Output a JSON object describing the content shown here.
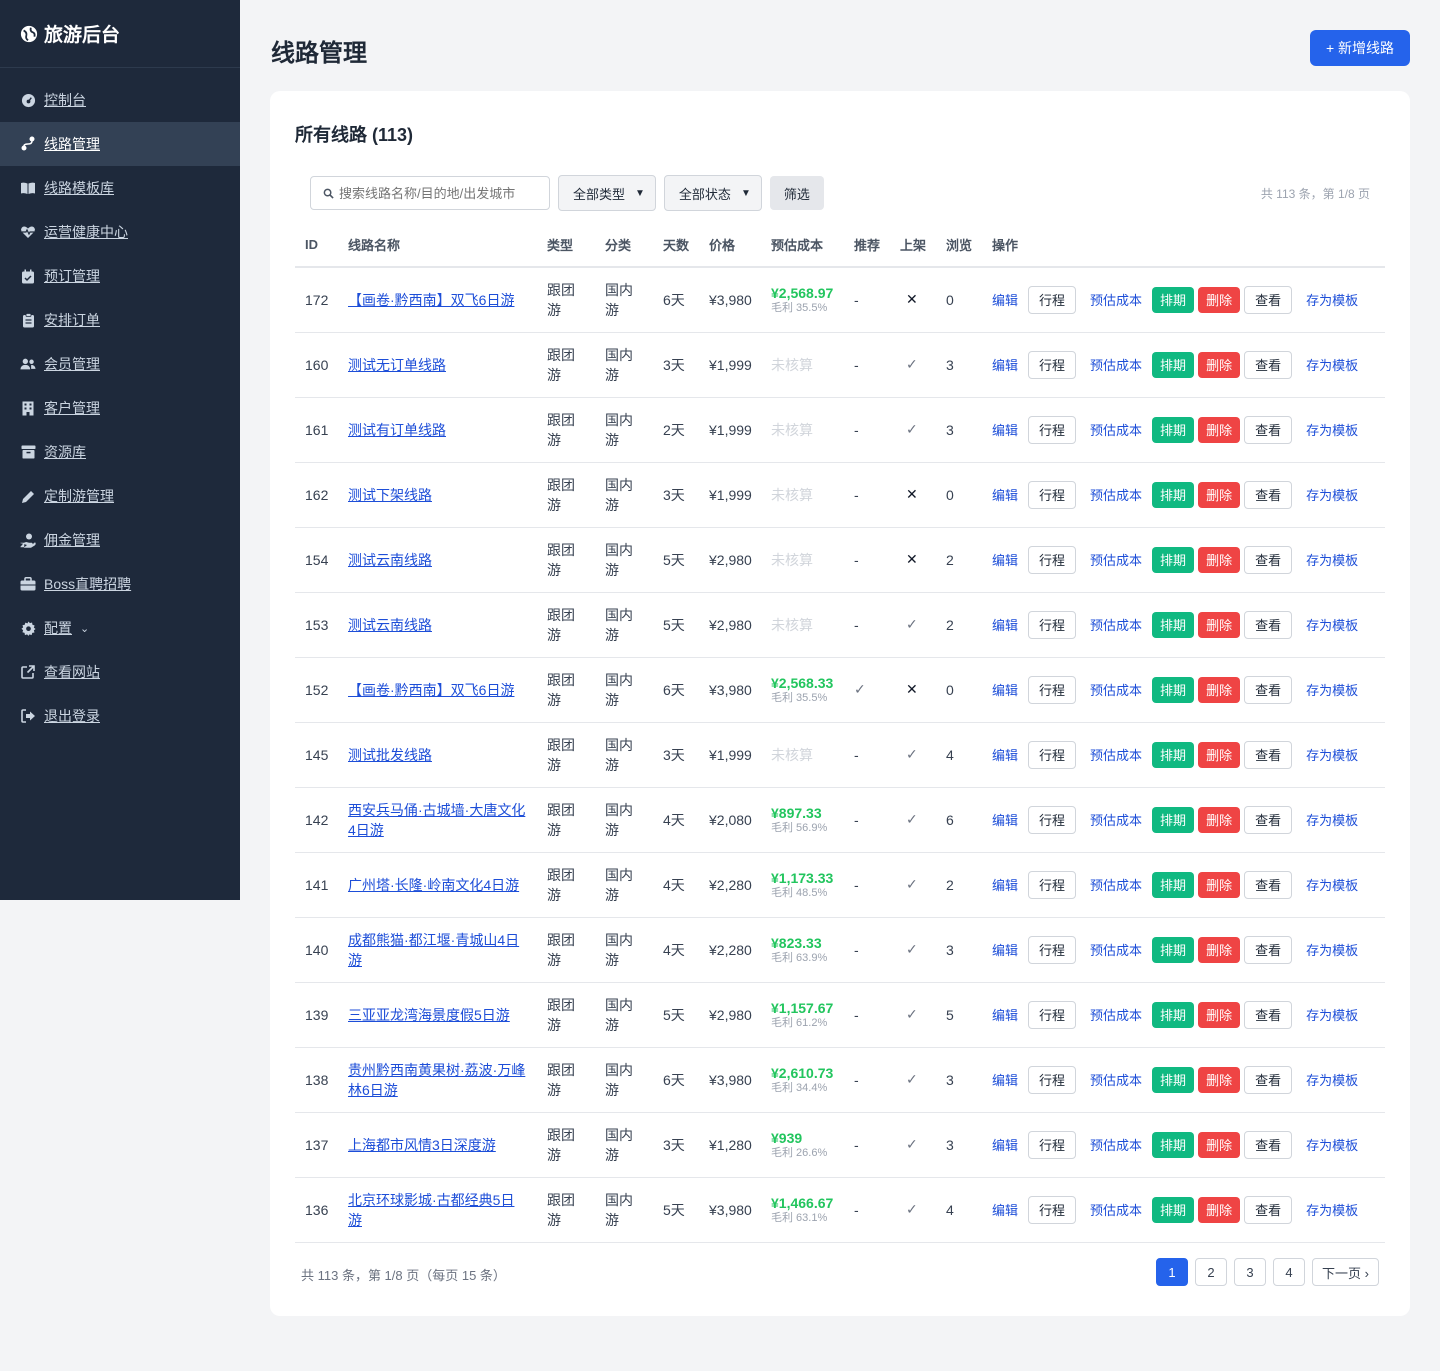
{
  "brand": {
    "title": "旅游后台",
    "icon": "globe-icon"
  },
  "sidebar": {
    "items": [
      {
        "label": "控制台",
        "icon": "dashboard-icon"
      },
      {
        "label": "线路管理",
        "icon": "route-icon",
        "active": true
      },
      {
        "label": "线路模板库",
        "icon": "book-icon"
      },
      {
        "label": "运营健康中心",
        "icon": "heartbeat-icon"
      },
      {
        "label": "预订管理",
        "icon": "calendar-check-icon"
      },
      {
        "label": "安排订单",
        "icon": "clipboard-icon"
      },
      {
        "label": "会员管理",
        "icon": "users-icon"
      },
      {
        "label": "客户管理",
        "icon": "building-icon"
      },
      {
        "label": "资源库",
        "icon": "archive-icon"
      },
      {
        "label": "定制游管理",
        "icon": "pen-icon"
      },
      {
        "label": "佣金管理",
        "icon": "hand-coin-icon"
      },
      {
        "label": "Boss直聘招聘",
        "icon": "briefcase-icon"
      },
      {
        "label": "配置",
        "icon": "gear-icon",
        "has_chevron": true
      },
      {
        "label": "查看网站",
        "icon": "external-link-icon"
      },
      {
        "label": "退出登录",
        "icon": "logout-icon"
      }
    ]
  },
  "header": {
    "title": "线路管理",
    "add_button": "+ 新增线路"
  },
  "card": {
    "title": "所有线路 (113)",
    "search_placeholder": "搜索线路名称/目的地/出发城市",
    "type_select": "全部类型",
    "status_select": "全部状态",
    "filter_button": "筛选",
    "summary_top": "共 113 条，第 1/8 页"
  },
  "table": {
    "columns": [
      "ID",
      "线路名称",
      "类型",
      "分类",
      "天数",
      "价格",
      "预估成本",
      "推荐",
      "上架",
      "浏览",
      "操作"
    ],
    "ops": {
      "edit": "编辑",
      "itinerary": "行程",
      "cost": "预估成本",
      "schedule": "排期",
      "delete": "删除",
      "view": "查看",
      "template": "存为模板"
    },
    "rows": [
      {
        "id": "172",
        "name": "【画卷·黔西南】双飞6日游",
        "type": "跟团游",
        "cat": "国内游",
        "days": "6天",
        "price": "¥3,980",
        "cost": "¥2,568.97",
        "margin": "毛利 35.5%",
        "rec": "-",
        "listed": "✕",
        "views": "0"
      },
      {
        "id": "160",
        "name": "测试无订单线路",
        "type": "跟团游",
        "cat": "国内游",
        "days": "3天",
        "price": "¥1,999",
        "cost": "",
        "margin": "",
        "uncalc": "未核算",
        "rec": "-",
        "listed": "✓",
        "views": "3"
      },
      {
        "id": "161",
        "name": "测试有订单线路",
        "type": "跟团游",
        "cat": "国内游",
        "days": "2天",
        "price": "¥1,999",
        "cost": "",
        "margin": "",
        "uncalc": "未核算",
        "rec": "-",
        "listed": "✓",
        "views": "3"
      },
      {
        "id": "162",
        "name": "测试下架线路",
        "type": "跟团游",
        "cat": "国内游",
        "days": "3天",
        "price": "¥1,999",
        "cost": "",
        "margin": "",
        "uncalc": "未核算",
        "rec": "-",
        "listed": "✕",
        "views": "0"
      },
      {
        "id": "154",
        "name": "测试云南线路",
        "type": "跟团游",
        "cat": "国内游",
        "days": "5天",
        "price": "¥2,980",
        "cost": "",
        "margin": "",
        "uncalc": "未核算",
        "rec": "-",
        "listed": "✕",
        "views": "2"
      },
      {
        "id": "153",
        "name": "测试云南线路",
        "type": "跟团游",
        "cat": "国内游",
        "days": "5天",
        "price": "¥2,980",
        "cost": "",
        "margin": "",
        "uncalc": "未核算",
        "rec": "-",
        "listed": "✓",
        "views": "2"
      },
      {
        "id": "152",
        "name": "【画卷·黔西南】双飞6日游",
        "type": "跟团游",
        "cat": "国内游",
        "days": "6天",
        "price": "¥3,980",
        "cost": "¥2,568.33",
        "margin": "毛利 35.5%",
        "rec": "✓",
        "listed": "✕",
        "views": "0"
      },
      {
        "id": "145",
        "name": "测试批发线路",
        "type": "跟团游",
        "cat": "国内游",
        "days": "3天",
        "price": "¥1,999",
        "cost": "",
        "margin": "",
        "uncalc": "未核算",
        "rec": "-",
        "listed": "✓",
        "views": "4"
      },
      {
        "id": "142",
        "name": "西安兵马俑·古城墙·大唐文化4日游",
        "type": "跟团游",
        "cat": "国内游",
        "days": "4天",
        "price": "¥2,080",
        "cost": "¥897.33",
        "margin": "毛利 56.9%",
        "rec": "-",
        "listed": "✓",
        "views": "6"
      },
      {
        "id": "141",
        "name": "广州塔·长隆·岭南文化4日游",
        "type": "跟团游",
        "cat": "国内游",
        "days": "4天",
        "price": "¥2,280",
        "cost": "¥1,173.33",
        "margin": "毛利 48.5%",
        "rec": "-",
        "listed": "✓",
        "views": "2"
      },
      {
        "id": "140",
        "name": "成都熊猫·都江堰·青城山4日游",
        "type": "跟团游",
        "cat": "国内游",
        "days": "4天",
        "price": "¥2,280",
        "cost": "¥823.33",
        "margin": "毛利 63.9%",
        "rec": "-",
        "listed": "✓",
        "views": "3"
      },
      {
        "id": "139",
        "name": "三亚亚龙湾海景度假5日游",
        "type": "跟团游",
        "cat": "国内游",
        "days": "5天",
        "price": "¥2,980",
        "cost": "¥1,157.67",
        "margin": "毛利 61.2%",
        "rec": "-",
        "listed": "✓",
        "views": "5"
      },
      {
        "id": "138",
        "name": "贵州黔西南黄果树·荔波·万峰林6日游",
        "type": "跟团游",
        "cat": "国内游",
        "days": "6天",
        "price": "¥3,980",
        "cost": "¥2,610.73",
        "margin": "毛利 34.4%",
        "rec": "-",
        "listed": "✓",
        "views": "3"
      },
      {
        "id": "137",
        "name": "上海都市风情3日深度游",
        "type": "跟团游",
        "cat": "国内游",
        "days": "3天",
        "price": "¥1,280",
        "cost": "¥939",
        "margin": "毛利 26.6%",
        "rec": "-",
        "listed": "✓",
        "views": "3"
      },
      {
        "id": "136",
        "name": "北京环球影城·古都经典5日游",
        "type": "跟团游",
        "cat": "国内游",
        "days": "5天",
        "price": "¥3,980",
        "cost": "¥1,466.67",
        "margin": "毛利 63.1%",
        "rec": "-",
        "listed": "✓",
        "views": "4"
      }
    ]
  },
  "footer": {
    "summary": "共 113 条，第 1/8 页（每页 15 条）",
    "pages": [
      "1",
      "2",
      "3",
      "4"
    ],
    "next": "下一页 ›"
  },
  "colors": {
    "sidebar_bg": "#1e293b",
    "primary": "#2563eb",
    "success": "#10b981",
    "danger": "#ef4444",
    "cost_green": "#22c55e"
  }
}
